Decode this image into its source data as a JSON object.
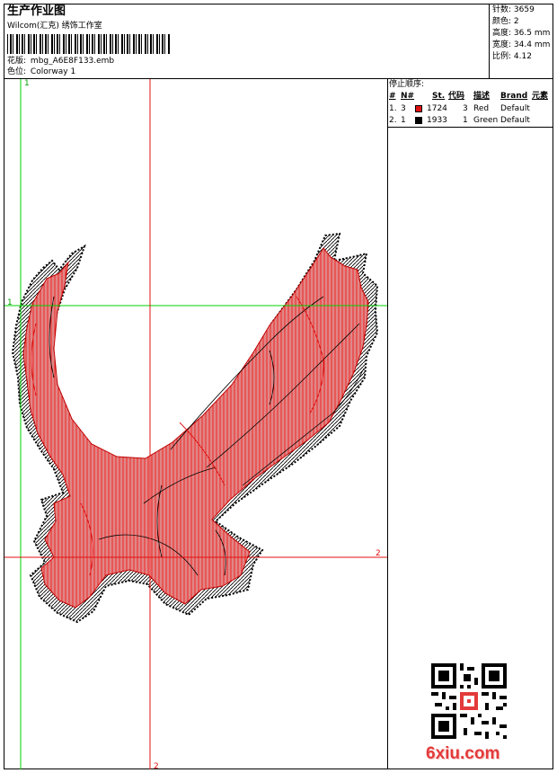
{
  "header": {
    "title": "生产作业图",
    "company": "Wilcom(汇克) 绣饰工作室",
    "design_label": "花版:",
    "design_value": "mbg_A6E8F133.emb",
    "colorway_label": "色位:",
    "colorway_value": "Colorway 1"
  },
  "stats": [
    {
      "label": "针数:",
      "value": "3659"
    },
    {
      "label": "颜色:",
      "value": "2"
    },
    {
      "label": "高度:",
      "value": "36.5 mm"
    },
    {
      "label": "宽度:",
      "value": "34.4 mm"
    },
    {
      "label": "比例:",
      "value": "4.12"
    }
  ],
  "stop_sequence": {
    "title": "停止顺序:",
    "columns": [
      "#",
      "N#",
      "St.",
      "代码",
      "描述",
      "Brand",
      "元素"
    ],
    "rows": [
      {
        "index": "1.",
        "needle": "3",
        "color": "#e01010",
        "stitches": "1724",
        "code": "3",
        "description": "Red",
        "brand": "Default"
      },
      {
        "index": "2.",
        "needle": "1",
        "color": "#000000",
        "stitches": "1933",
        "code": "1",
        "description": "Green",
        "brand": "Default"
      }
    ]
  },
  "guides": {
    "v1_label": "1",
    "h1_label": "1",
    "h2_label": "2",
    "v2_label": "2"
  },
  "watermark": "6xiu.com",
  "colors": {
    "guide_green": "#00d000",
    "guide_red": "#e01010",
    "stitch_red": "#e01010",
    "stitch_black": "#000000"
  }
}
